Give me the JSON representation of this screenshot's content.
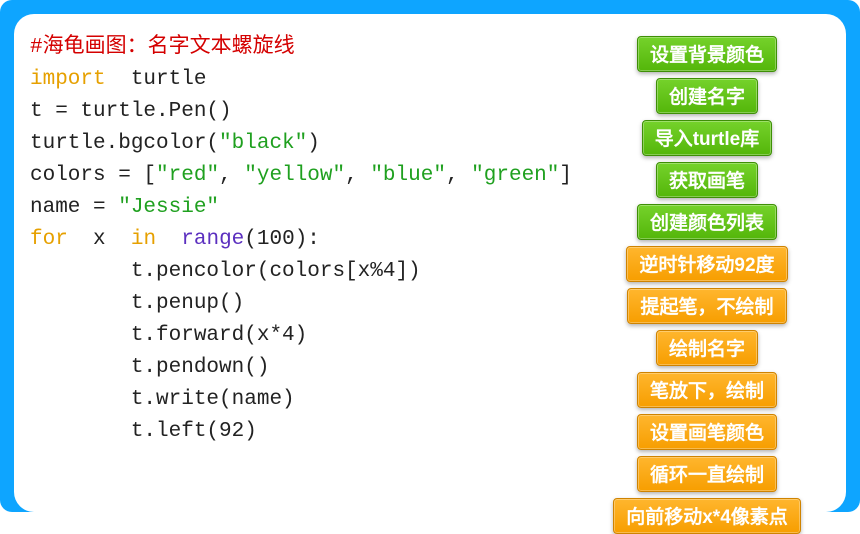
{
  "code": {
    "comment": "#海龟画图：名字文本螺旋线",
    "line2_import": "import",
    "line2_rest": "  turtle",
    "line3": "t = turtle.Pen()",
    "line4_a": "turtle.bgcolor(",
    "line4_b": "\"black\"",
    "line4_c": ")",
    "line5_a": "colors = [",
    "line5_red": "\"red\"",
    "line5_s1": ", ",
    "line5_yellow": "\"yellow\"",
    "line5_s2": ", ",
    "line5_blue": "\"blue\"",
    "line5_s3": ", ",
    "line5_green": "\"green\"",
    "line5_b": "]",
    "line6_a": "name = ",
    "line6_b": "\"Jessie\"",
    "line7_for": "for",
    "line7_s1": "  ",
    "line7_x": "x ",
    "line7_in": " in ",
    "line7_range": " range",
    "line7_tail": "(100):",
    "line8": "        t.pencolor(colors[x%4])",
    "line9": "        t.penup()",
    "line10": "        t.forward(x*4)",
    "line11": "        t.pendown()",
    "line12": "        t.write(name)",
    "line13": "        t.left(92)"
  },
  "labels": [
    {
      "text": "设置背景颜色",
      "color": "green"
    },
    {
      "text": "创建名字",
      "color": "green"
    },
    {
      "text": "导入turtle库",
      "color": "green"
    },
    {
      "text": "获取画笔",
      "color": "green"
    },
    {
      "text": "创建颜色列表",
      "color": "green"
    },
    {
      "text": "逆时针移动92度",
      "color": "orange"
    },
    {
      "text": "提起笔，不绘制",
      "color": "orange"
    },
    {
      "text": "绘制名字",
      "color": "orange"
    },
    {
      "text": "笔放下，绘制",
      "color": "orange"
    },
    {
      "text": "设置画笔颜色",
      "color": "orange"
    },
    {
      "text": "循环一直绘制",
      "color": "orange"
    },
    {
      "text": "向前移动x*4像素点",
      "color": "orange"
    }
  ]
}
